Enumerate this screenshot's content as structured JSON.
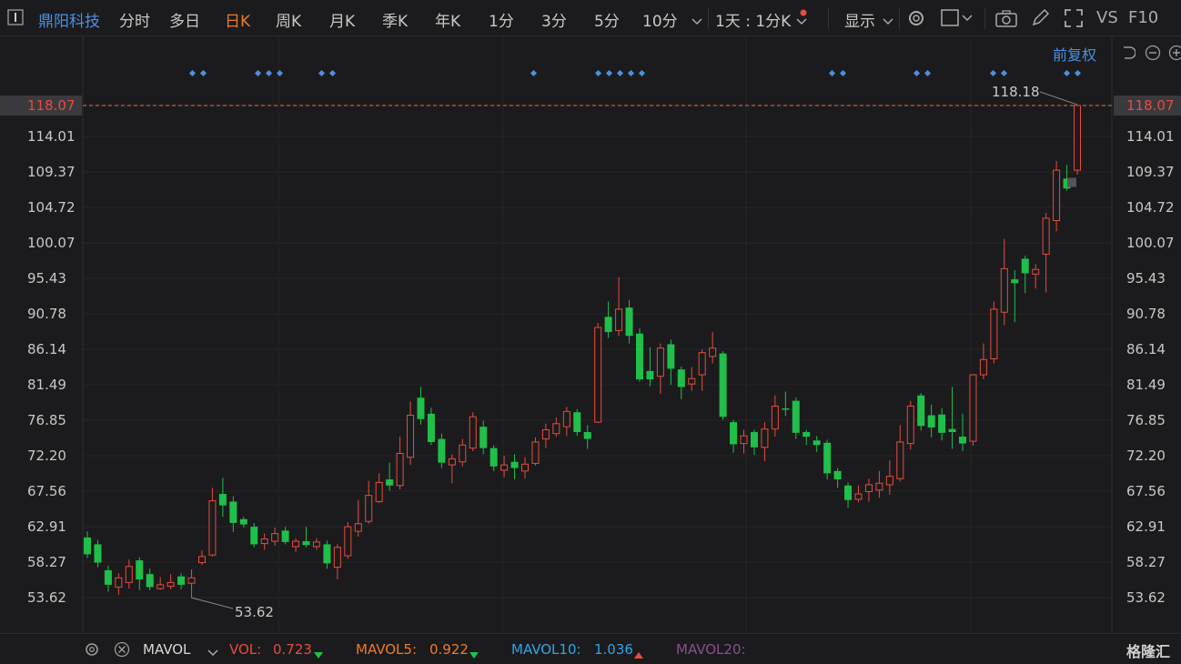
{
  "toolbar": {
    "stock_name": "鼎阳科技",
    "tabs": [
      "分时",
      "多日",
      "日K",
      "周K",
      "月K",
      "季K",
      "年K",
      "1分",
      "3分",
      "5分",
      "10分"
    ],
    "active_tab": "日K",
    "interval": "1天 : 1分K",
    "display": "显示",
    "vs": "VS",
    "f10": "F10"
  },
  "adjust": "前复权",
  "chart_data": {
    "type": "candlestick",
    "y_ticks": [
      "118.07",
      "114.01",
      "109.37",
      "104.72",
      "100.07",
      "95.43",
      "90.78",
      "86.14",
      "81.49",
      "76.85",
      "72.20",
      "67.56",
      "62.91",
      "58.27",
      "53.62"
    ],
    "ylim": [
      50,
      123
    ],
    "current_price": "118.07",
    "max_label": "118.18",
    "min_label": "53.62",
    "up_color": "#e74c3c",
    "down_color": "#1fbf4a",
    "candles": [
      [
        61.5,
        59.3,
        62.3,
        58.8
      ],
      [
        60.6,
        58.2,
        61.2,
        57.6
      ],
      [
        57.2,
        55.3,
        57.8,
        54.4
      ],
      [
        55.0,
        56.2,
        56.8,
        54.0
      ],
      [
        55.6,
        57.7,
        58.6,
        54.8
      ],
      [
        58.5,
        56.0,
        58.9,
        54.6
      ],
      [
        56.7,
        55.0,
        57.4,
        54.6
      ],
      [
        54.8,
        55.3,
        56.3,
        54.6
      ],
      [
        55.1,
        55.6,
        56.7,
        54.7
      ],
      [
        56.4,
        55.3,
        56.8,
        54.7
      ],
      [
        55.5,
        56.2,
        57.3,
        53.6
      ],
      [
        58.2,
        59.0,
        59.8,
        57.9
      ],
      [
        59.2,
        66.3,
        68.0,
        59.0
      ],
      [
        67.2,
        65.7,
        69.3,
        64.2
      ],
      [
        66.2,
        63.4,
        66.9,
        62.2
      ],
      [
        63.9,
        63.2,
        64.2,
        62.8
      ],
      [
        62.9,
        60.6,
        63.4,
        60.2
      ],
      [
        60.7,
        61.3,
        62.0,
        59.9
      ],
      [
        61.0,
        62.0,
        62.8,
        60.4
      ],
      [
        62.4,
        60.9,
        62.9,
        60.6
      ],
      [
        60.3,
        61.0,
        61.4,
        59.6
      ],
      [
        61.0,
        60.5,
        62.9,
        60.2
      ],
      [
        60.3,
        60.9,
        61.4,
        59.9
      ],
      [
        60.6,
        58.1,
        61.1,
        57.4
      ],
      [
        57.6,
        60.2,
        60.6,
        56.0
      ],
      [
        59.1,
        62.9,
        63.5,
        58.7
      ],
      [
        62.3,
        63.3,
        66.4,
        61.6
      ],
      [
        63.6,
        67.0,
        68.9,
        63.3
      ],
      [
        66.2,
        68.7,
        69.9,
        66.0
      ],
      [
        69.1,
        68.3,
        71.3,
        67.6
      ],
      [
        68.3,
        72.5,
        74.7,
        67.8
      ],
      [
        72.0,
        77.5,
        79.3,
        71.0
      ],
      [
        79.8,
        77.0,
        81.2,
        76.3
      ],
      [
        77.7,
        74.0,
        78.5,
        73.6
      ],
      [
        74.4,
        71.3,
        75.1,
        70.6
      ],
      [
        71.0,
        71.8,
        72.4,
        68.6
      ],
      [
        71.4,
        73.6,
        74.4,
        70.8
      ],
      [
        73.2,
        77.3,
        77.9,
        72.8
      ],
      [
        76.0,
        73.2,
        76.8,
        72.4
      ],
      [
        73.2,
        70.8,
        73.6,
        70.2
      ],
      [
        70.3,
        71.0,
        72.2,
        69.4
      ],
      [
        71.4,
        70.6,
        72.4,
        69.1
      ],
      [
        70.2,
        71.1,
        72.0,
        69.2
      ],
      [
        71.2,
        74.0,
        74.6,
        70.9
      ],
      [
        74.4,
        75.6,
        76.4,
        73.2
      ],
      [
        75.1,
        76.4,
        77.2,
        74.7
      ],
      [
        76.0,
        78.0,
        78.6,
        74.8
      ],
      [
        77.9,
        75.3,
        78.3,
        74.8
      ],
      [
        75.3,
        74.4,
        76.2,
        73.1
      ],
      [
        76.6,
        89.0,
        89.6,
        76.5
      ],
      [
        90.4,
        88.4,
        92.4,
        87.6
      ],
      [
        88.6,
        91.4,
        95.6,
        87.9
      ],
      [
        91.6,
        87.9,
        92.6,
        86.9
      ],
      [
        88.2,
        82.2,
        88.9,
        81.9
      ],
      [
        83.3,
        82.2,
        86.4,
        81.3
      ],
      [
        82.6,
        86.3,
        86.9,
        80.3
      ],
      [
        86.8,
        83.6,
        87.4,
        81.5
      ],
      [
        83.5,
        81.2,
        83.9,
        79.6
      ],
      [
        81.6,
        82.3,
        83.8,
        80.7
      ],
      [
        82.8,
        85.7,
        86.1,
        80.7
      ],
      [
        85.2,
        86.3,
        88.4,
        84.3
      ],
      [
        85.6,
        77.3,
        85.9,
        76.9
      ],
      [
        76.6,
        73.7,
        76.9,
        72.6
      ],
      [
        73.8,
        74.8,
        75.6,
        72.5
      ],
      [
        75.3,
        73.3,
        75.6,
        72.3
      ],
      [
        73.3,
        75.7,
        76.6,
        71.5
      ],
      [
        75.7,
        78.7,
        80.1,
        74.7
      ],
      [
        78.4,
        78.3,
        80.6,
        77.4
      ],
      [
        79.4,
        75.2,
        79.8,
        74.4
      ],
      [
        75.3,
        74.7,
        75.6,
        73.6
      ],
      [
        74.2,
        73.6,
        74.8,
        72.7
      ],
      [
        73.9,
        69.9,
        74.3,
        69.1
      ],
      [
        70.2,
        69.1,
        70.6,
        68.0
      ],
      [
        68.3,
        66.4,
        68.7,
        65.4
      ],
      [
        66.5,
        67.2,
        68.3,
        66.1
      ],
      [
        67.5,
        68.4,
        69.2,
        66.2
      ],
      [
        67.7,
        68.6,
        70.2,
        66.7
      ],
      [
        68.4,
        69.5,
        71.6,
        67.1
      ],
      [
        69.2,
        74.0,
        76.2,
        68.8
      ],
      [
        73.8,
        78.7,
        79.4,
        73.0
      ],
      [
        80.1,
        76.1,
        80.4,
        75.5
      ],
      [
        77.5,
        75.9,
        78.9,
        74.6
      ],
      [
        77.6,
        75.2,
        78.4,
        74.2
      ],
      [
        75.7,
        75.3,
        81.2,
        73.1
      ],
      [
        74.7,
        73.8,
        77.7,
        72.8
      ],
      [
        74.1,
        82.8,
        82.9,
        73.5
      ],
      [
        82.8,
        84.8,
        86.9,
        82.2
      ],
      [
        84.9,
        91.4,
        92.4,
        84.3
      ],
      [
        91.0,
        96.7,
        100.6,
        89.3
      ],
      [
        95.3,
        94.8,
        96.5,
        89.7
      ],
      [
        98.0,
        96.1,
        98.4,
        93.5
      ],
      [
        96.0,
        96.6,
        97.3,
        94.1
      ],
      [
        98.6,
        103.3,
        104.0,
        93.6
      ],
      [
        103.0,
        109.6,
        110.8,
        101.6
      ],
      [
        108.5,
        107.2,
        110.3,
        106.9
      ],
      [
        109.6,
        118.07,
        118.18,
        109.0
      ]
    ]
  },
  "volume": {
    "label": "MAVOL",
    "vol_label": "VOL:",
    "vol_value": "0.723",
    "mavol5_label": "MAVOL5:",
    "mavol5_value": "0.922",
    "mavol10_label": "MAVOL10:",
    "mavol10_value": "1.036",
    "mavol20_label": "MAVOL20:"
  },
  "brand": "格隆汇"
}
